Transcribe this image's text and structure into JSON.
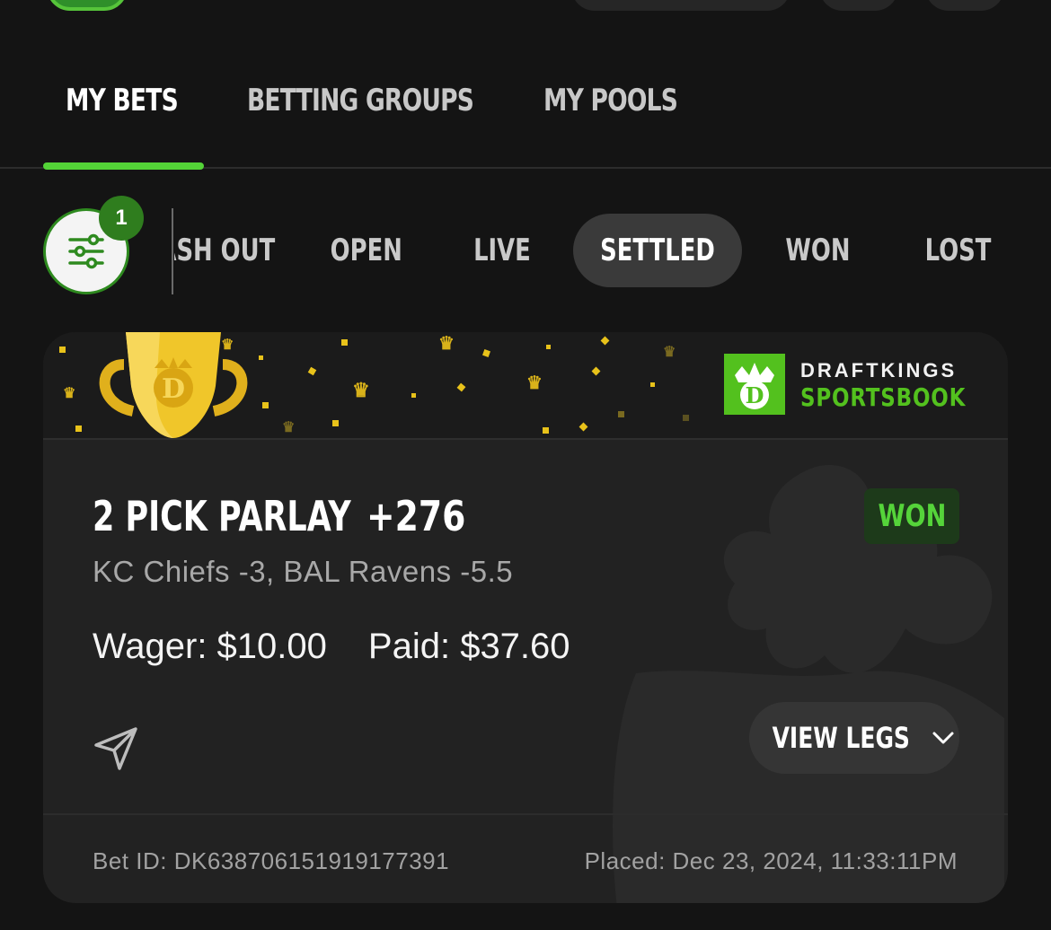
{
  "main_tabs": [
    {
      "label": "MY BETS",
      "active": true
    },
    {
      "label": "BETTING GROUPS",
      "active": false
    },
    {
      "label": "MY POOLS",
      "active": false
    }
  ],
  "filter": {
    "badge_count": "1"
  },
  "status_chips": [
    {
      "label": "CASH OUT",
      "active": false
    },
    {
      "label": "OPEN",
      "active": false
    },
    {
      "label": "LIVE",
      "active": false
    },
    {
      "label": "SETTLED",
      "active": true
    },
    {
      "label": "WON",
      "active": false
    },
    {
      "label": "LOST",
      "active": false
    }
  ],
  "card": {
    "logo_line1": "DRAFTKINGS",
    "logo_line2": "SPORTSBOOK",
    "bet_type": "2 PICK PARLAY",
    "odds": "+276",
    "result": "WON",
    "legs": "KC Chiefs -3, BAL Ravens -5.5",
    "wager": "Wager: $10.00",
    "paid": "Paid: $37.60",
    "view_legs_label": "VIEW LEGS",
    "bet_id": "Bet ID: DK638706151919177391",
    "placed": "Placed: Dec 23, 2024, 11:33:11PM"
  },
  "colors": {
    "accent_green": "#53d337",
    "background": "#141414",
    "card": "#222222",
    "won_text": "#55d43a"
  }
}
